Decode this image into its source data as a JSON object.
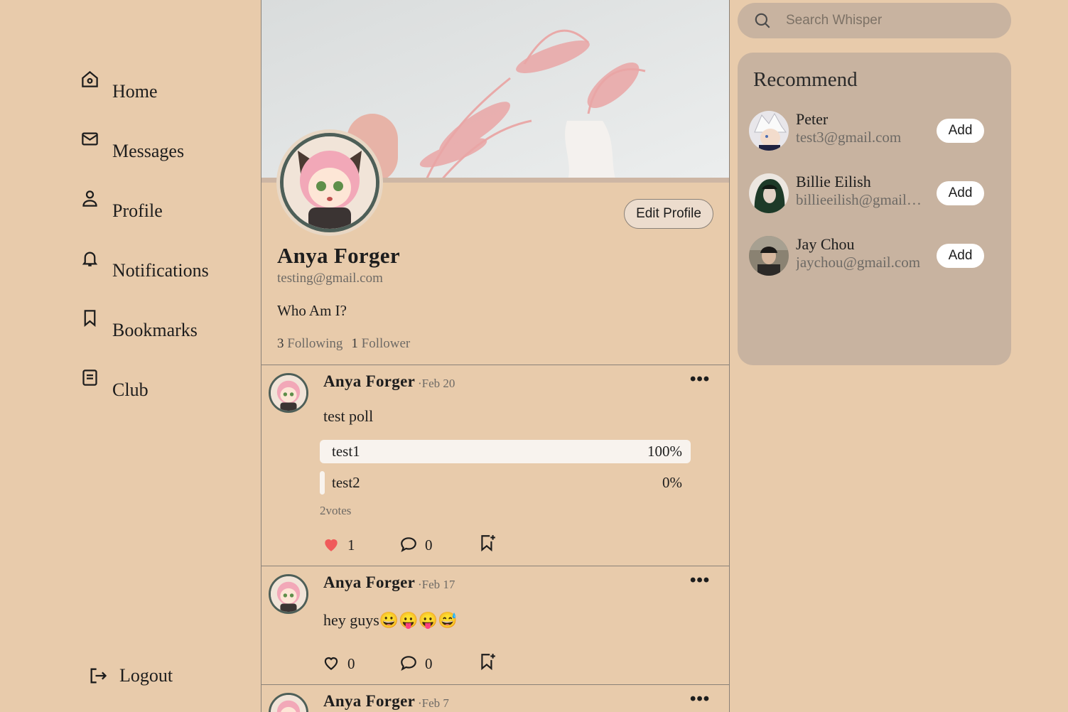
{
  "nav": {
    "items": [
      {
        "label": "Home",
        "icon": "home-icon"
      },
      {
        "label": "Messages",
        "icon": "mail-icon"
      },
      {
        "label": "Profile",
        "icon": "user-icon"
      },
      {
        "label": "Notifications",
        "icon": "bell-icon"
      },
      {
        "label": "Bookmarks",
        "icon": "bookmark-icon"
      },
      {
        "label": "Club",
        "icon": "document-icon"
      }
    ],
    "logout": "Logout"
  },
  "profile": {
    "name": "Anya Forger",
    "email": "testing@gmail.com",
    "bio": "Who Am I?",
    "following_count": "3",
    "following_label": "Following",
    "follower_count": "1",
    "follower_label": "Follower",
    "edit_button": "Edit Profile"
  },
  "posts": [
    {
      "author": "Anya Forger",
      "date": "·Feb 20",
      "text": "test poll",
      "poll": {
        "options": [
          {
            "label": "test1",
            "percent_text": "100%",
            "fraction": 1.0
          },
          {
            "label": "test2",
            "percent_text": "0%",
            "fraction": 0.0
          }
        ],
        "votes": "2votes"
      },
      "likes": "1",
      "liked": true,
      "comments": "0"
    },
    {
      "author": "Anya Forger",
      "date": "·Feb 17",
      "text": "hey guys😀😛😛😅",
      "likes": "0",
      "liked": false,
      "comments": "0"
    },
    {
      "author": "Anya Forger",
      "date": "·Feb 7"
    }
  ],
  "search": {
    "placeholder": "Search Whisper"
  },
  "recommend": {
    "title": "Recommend",
    "add_label": "Add",
    "users": [
      {
        "name": "Peter",
        "email": "test3@gmail.com"
      },
      {
        "name": "Billie Eilish",
        "email": "billieeilish@gmail.com"
      },
      {
        "name": "Jay Chou",
        "email": "jaychou@gmail.com"
      }
    ]
  },
  "colors": {
    "background": "#e8cbab",
    "panel": "#c8b3a0",
    "like_active": "#f05a5a",
    "avatar_ring": "#4e5f58"
  }
}
